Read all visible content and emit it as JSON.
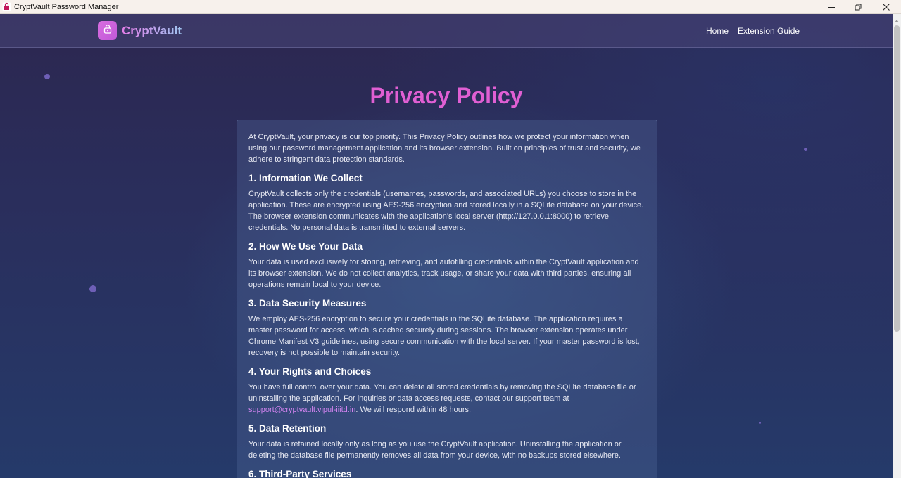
{
  "window": {
    "title": "CryptVault Password Manager",
    "app_icon": "app-logo-icon",
    "controls": [
      "minimize-icon",
      "restore-icon",
      "close-icon"
    ]
  },
  "navbar": {
    "brand": "CryptVault",
    "brand_icon": "lock-icon",
    "links": [
      "Home",
      "Extension Guide"
    ]
  },
  "page": {
    "title": "Privacy Policy",
    "intro": "At CryptVault, your privacy is our top priority. This Privacy Policy outlines how we protect your information when using our password management application and its browser extension. Built on principles of trust and security, we adhere to stringent data protection standards.",
    "sections": [
      {
        "heading": "1. Information We Collect",
        "body": "CryptVault collects only the credentials (usernames, passwords, and associated URLs) you choose to store in the application. These are encrypted using AES-256 encryption and stored locally in a SQLite database on your device. The browser extension communicates with the application's local server (http://127.0.0.1:8000) to retrieve credentials. No personal data is transmitted to external servers."
      },
      {
        "heading": "2. How We Use Your Data",
        "body": "Your data is used exclusively for storing, retrieving, and autofilling credentials within the CryptVault application and its browser extension. We do not collect analytics, track usage, or share your data with third parties, ensuring all operations remain local to your device."
      },
      {
        "heading": "3. Data Security Measures",
        "body": "We employ AES-256 encryption to secure your credentials in the SQLite database. The application requires a master password for access, which is cached securely during sessions. The browser extension operates under Chrome Manifest V3 guidelines, using secure communication with the local server. If your master password is lost, recovery is not possible to maintain security."
      },
      {
        "heading": "4. Your Rights and Choices",
        "body_before": "You have full control over your data. You can delete all stored credentials by removing the SQLite database file or uninstalling the application. For inquiries or data access requests, contact our support team at ",
        "link": "support@cryptvault.vipul-iiitd.in",
        "body_after": ". We will respond within 48 hours."
      },
      {
        "heading": "5. Data Retention",
        "body": "Your data is retained locally only as long as you use the CryptVault application. Uninstalling the application or deleting the database file permanently removes all data from your device, with no backups stored elsewhere."
      },
      {
        "heading": "6. Third-Party Services"
      }
    ]
  },
  "colors": {
    "accent": "#e05fd3",
    "link": "#d584f2",
    "background": "#2a2e5c"
  }
}
